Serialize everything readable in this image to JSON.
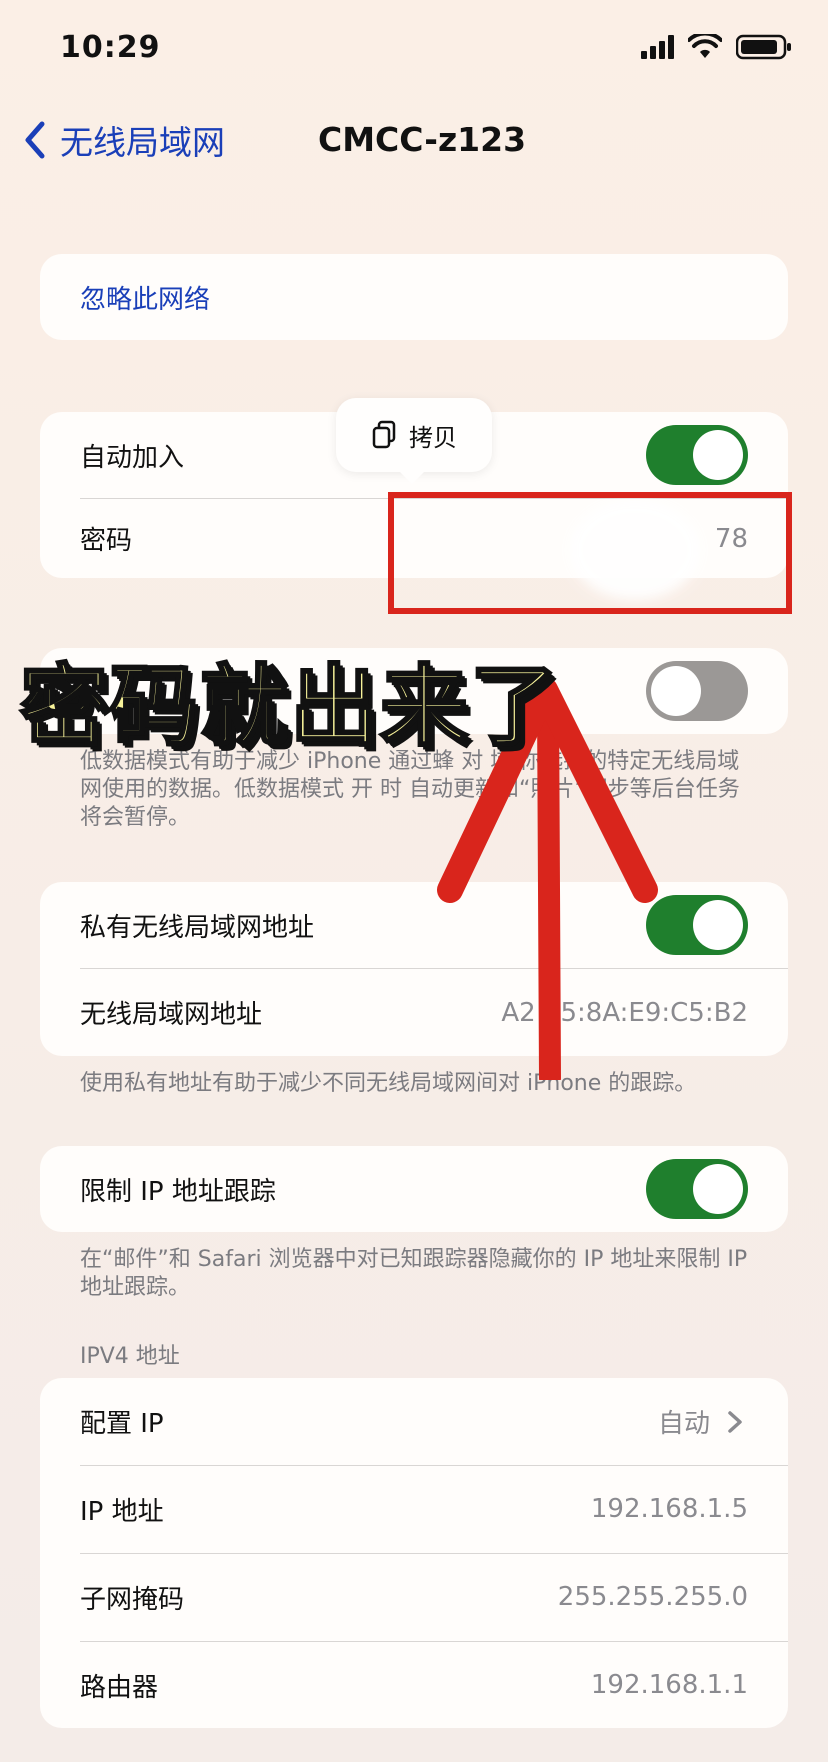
{
  "status_bar": {
    "time": "10:29"
  },
  "nav": {
    "back_label": "无线局域网",
    "title": "CMCC-z123"
  },
  "forget": {
    "label": "忽略此网络"
  },
  "auto_join": {
    "label": "自动加入",
    "toggle": "on"
  },
  "password": {
    "label": "密码",
    "value": "78"
  },
  "copy_popup": {
    "label": "拷贝"
  },
  "overlay": {
    "caption": "密码就出来了"
  },
  "low_data": {
    "toggle": "off",
    "description": "低数据模式有助于减少 iPhone 通过蜂 对 域 你选择的特定无线局域网使用的数据。低数据模式 开 时 自动更新和“照片”同步等后台任务将会暂停。"
  },
  "private_address": {
    "label": "私有无线局域网地址",
    "toggle": "on",
    "address_label": "无线局域网地址",
    "address_value": "A2 05:8A:E9:C5:B2",
    "description": "使用私有地址有助于减少不同无线局域网间对 iPhone 的跟踪。"
  },
  "limit_ip": {
    "label": "限制 IP 地址跟踪",
    "toggle": "on",
    "description": "在“邮件”和 Safari 浏览器中对已知跟踪器隐藏你的 IP 地址来限制 IP 地址跟踪。"
  },
  "ipv4": {
    "header": "IPV4 地址",
    "rows": [
      {
        "label": "配置 IP",
        "value": "自动"
      },
      {
        "label": "IP 地址",
        "value": "192.168.1.5"
      },
      {
        "label": "子网掩码",
        "value": "255.255.255.0"
      },
      {
        "label": "路由器",
        "value": "192.168.1.1"
      }
    ]
  },
  "colors": {
    "accent": "#1a3fb8",
    "toggle_on": "#1f7f2d",
    "annotation_red": "#d9251c",
    "caption_yellow": "#f7f29a"
  }
}
